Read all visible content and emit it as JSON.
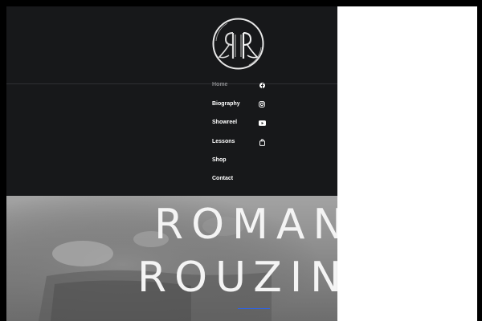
{
  "brand": {
    "logo_name": "RR monogram logo"
  },
  "nav": {
    "items": [
      {
        "label": "Home",
        "active": true
      },
      {
        "label": "Biography",
        "active": false
      },
      {
        "label": "Showreel",
        "active": false
      },
      {
        "label": "Lessons",
        "active": false
      },
      {
        "label": "Shop",
        "active": false
      },
      {
        "label": "Contact",
        "active": false
      }
    ]
  },
  "social": {
    "icons": [
      "facebook-icon",
      "instagram-icon",
      "youtube-icon",
      "shopping-bag-icon"
    ]
  },
  "hero": {
    "line1": "ROMAN",
    "line2": "ROUZIN"
  },
  "colors": {
    "header_bg": "#17181a",
    "nav_text": "#ffffff",
    "nav_active": "#8c8d90",
    "accent": "#2e63e6",
    "frame": "#000000"
  }
}
